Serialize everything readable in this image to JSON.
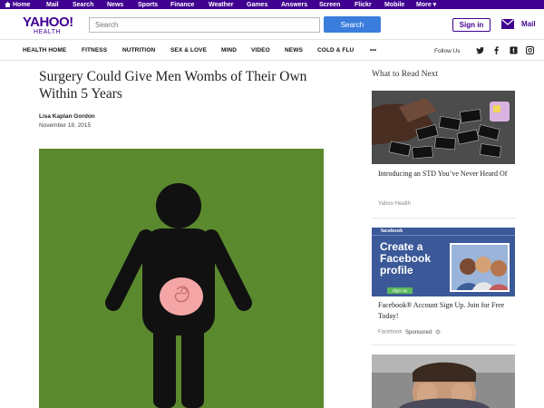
{
  "topbar": {
    "items": [
      "Home",
      "Mail",
      "Search",
      "News",
      "Sports",
      "Finance",
      "Weather",
      "Games",
      "Answers",
      "Screen",
      "Flickr",
      "Mobile",
      "More ▾"
    ]
  },
  "header": {
    "logo_brand": "YAHOO!",
    "logo_sub": "HEALTH",
    "search_placeholder": "Search",
    "search_button": "Search",
    "signin": "Sign in",
    "mail": "Mail"
  },
  "nav": {
    "items": [
      "HEALTH HOME",
      "FITNESS",
      "NUTRITION",
      "SEX & LOVE",
      "MIND",
      "VIDEO",
      "NEWS",
      "COLD & FLU",
      "•••"
    ],
    "follow_label": "Follow Us",
    "social_icons": [
      "twitter-icon",
      "facebook-icon",
      "tumblr-icon",
      "instagram-icon"
    ]
  },
  "article": {
    "headline": "Surgery Could Give Men Wombs of Their Own Within 5 Years",
    "author": "Lisa Kaplan Gordon",
    "date": "November 18, 2015"
  },
  "sidebar": {
    "heading": "What to Read Next",
    "cards": [
      {
        "title": "Introducing an STD You’ve Never Heard Of",
        "source": "Yahoo Health",
        "sponsored": ""
      },
      {
        "title": "Facebook® Account Sign Up. Join for Free Today!",
        "source": "Facebook",
        "sponsored": "Sponsored",
        "ad_brand": "facebook",
        "ad_headline_1": "Create a",
        "ad_headline_2": "Facebook",
        "ad_headline_3": "profile",
        "ad_button": "Sign Up"
      }
    ]
  },
  "colors": {
    "brand_purple": "#400090",
    "search_blue": "#3b7ddd",
    "hero_green": "#5b8a2e",
    "facebook_blue": "#3b5998"
  }
}
